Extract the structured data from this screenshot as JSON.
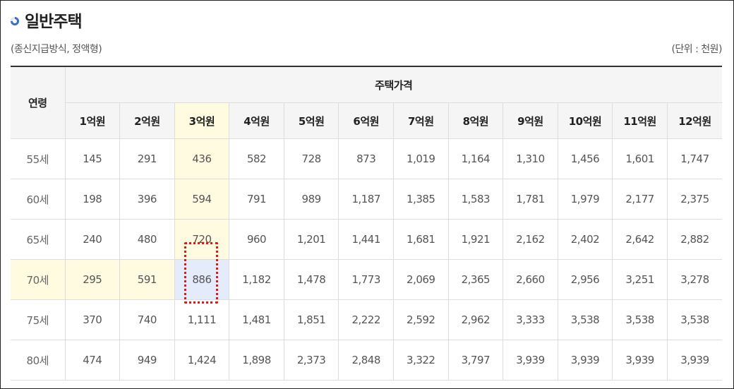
{
  "page": {
    "title": "일반주택",
    "subtitle": "(종신지급방식, 정액형)",
    "unit": "(단위 : 천원)"
  },
  "table": {
    "age_header": "연령",
    "price_header": "주택가격",
    "columns": [
      "1억원",
      "2억원",
      "3억원",
      "4억원",
      "5억원",
      "6억원",
      "7억원",
      "8억원",
      "9억원",
      "10억원",
      "11억원",
      "12억원"
    ],
    "rows": [
      {
        "age": "55세",
        "values": [
          "145",
          "291",
          "436",
          "582",
          "728",
          "873",
          "1,019",
          "1,164",
          "1,310",
          "1,456",
          "1,601",
          "1,747"
        ]
      },
      {
        "age": "60세",
        "values": [
          "198",
          "396",
          "594",
          "791",
          "989",
          "1,187",
          "1,385",
          "1,583",
          "1,781",
          "1,979",
          "2,177",
          "2,375"
        ]
      },
      {
        "age": "65세",
        "values": [
          "240",
          "480",
          "720",
          "960",
          "1,201",
          "1,441",
          "1,681",
          "1,921",
          "2,162",
          "2,402",
          "2,642",
          "2,882"
        ]
      },
      {
        "age": "70세",
        "values": [
          "295",
          "591",
          "886",
          "1,182",
          "1,478",
          "1,773",
          "2,069",
          "2,365",
          "2,660",
          "2,956",
          "3,251",
          "3,278"
        ]
      },
      {
        "age": "75세",
        "values": [
          "370",
          "740",
          "1,111",
          "1,481",
          "1,851",
          "2,222",
          "2,592",
          "2,962",
          "3,333",
          "3,538",
          "3,538",
          "3,538"
        ]
      },
      {
        "age": "80세",
        "values": [
          "474",
          "949",
          "1,424",
          "1,898",
          "2,373",
          "2,848",
          "3,322",
          "3,797",
          "3,939",
          "3,939",
          "3,939",
          "3,939"
        ]
      }
    ],
    "highlight": {
      "column_index": 2,
      "row_index": 3,
      "column_color": "#fffbe1",
      "row_color": "#fffbe1",
      "cell_color": "#e4ebfb",
      "marker_color": "#ee1111"
    }
  }
}
